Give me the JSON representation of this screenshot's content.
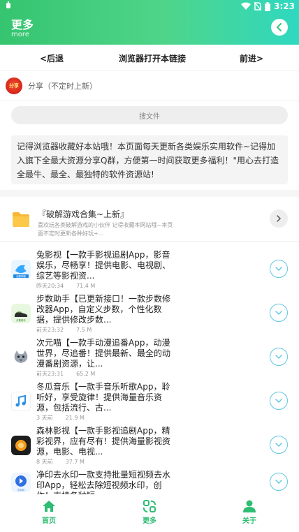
{
  "status": {
    "left_icon": "debug-icon",
    "time": "3:23"
  },
  "header": {
    "title": "更多",
    "subtitle": "more",
    "back_icon": "chevron-left-icon"
  },
  "nav": {
    "back": "<后退",
    "open_browser": "浏览器打开本链接",
    "forward": "前进>"
  },
  "share": {
    "icon_text": "分享",
    "label": "分享（不定时上新）"
  },
  "search": {
    "placeholder": "搜文件"
  },
  "notice": "记得浏览器收藏好本站哦！本页面每天更新各类娱乐实用软件~记得加入旗下全最大资源分享Q群，方便第一时间获取更多福利！\"用心去打造全最牛、最全、最独特的软件资源站!",
  "folder": {
    "title": "『破解游戏合集~上新』",
    "desc": "喜欢玩各类破解游戏的小伙伴 记得收藏本网站哦~本页面不定时更新各种好玩+..."
  },
  "apps": [
    {
      "title": "兔影视【一款手影视追剧App，影音娱乐，尽畅享！提供电影、电视剧、综艺等影视资...",
      "date": "昨天20:34",
      "size": "71.4 M",
      "icon": "rabbit-tv-icon",
      "icon_caption": "追剧神器"
    },
    {
      "title": "步数助手【已更新接口！一款步数修改器App，自定义步数，个性化数据，提供修改步数...",
      "date": "前天23:32",
      "size": "7.5 M",
      "icon": "shoe-step-icon",
      "icon_caption": "步数助手"
    },
    {
      "title": "次元喵【一款手动漫追番App，动漫世界，尽追番！提供最新、最全的动漫番剧资源，让...",
      "date": "前天23:31",
      "size": "65.2 M",
      "icon": "cat-icon"
    },
    {
      "title": "冬瓜音乐【一款手音乐听歌App，聆听好，享受旋律！提供海量音乐资源，包括流行、古...",
      "date": "3 天前",
      "size": "21.9 M",
      "icon": "music-note-icon"
    },
    {
      "title": "森林影视【一款手影视追剧App，精彩视界，应有尽有！提供海量影视资源，电影、电视...",
      "date": "8 天前",
      "size": "37.7 M",
      "icon": "forest-play-icon"
    },
    {
      "title": "净印去水印一款支持批量短视频去水印App，轻松去除短视频水印，创作！支持各种短...",
      "date": "",
      "size": "",
      "icon": "watermark-remove-icon",
      "icon_caption": "去水印"
    }
  ],
  "tabs": [
    {
      "label": "首页",
      "icon": "home-icon"
    },
    {
      "label": "更多",
      "icon": "more-apps-icon"
    },
    {
      "label": "关于",
      "icon": "user-icon"
    }
  ],
  "colors": {
    "accent": "#2fbd73",
    "header_start": "#35c46f",
    "header_end": "#2fd8c0",
    "download": "#5fc9e0"
  }
}
